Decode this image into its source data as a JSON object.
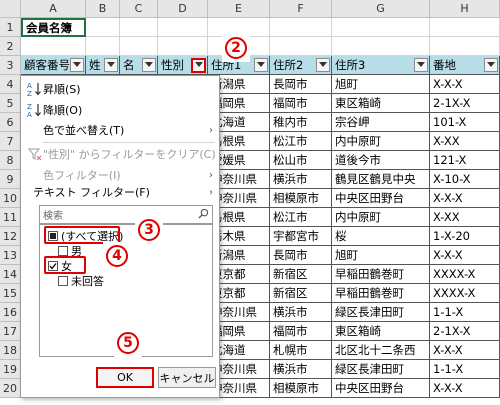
{
  "columns": [
    "A",
    "B",
    "C",
    "D",
    "E",
    "F",
    "G",
    "H"
  ],
  "row_numbers": [
    "1",
    "2",
    "3",
    "4",
    "5",
    "6",
    "7",
    "8",
    "9",
    "10",
    "11",
    "12",
    "13",
    "14",
    "15",
    "16",
    "17",
    "18",
    "19",
    "20"
  ],
  "sheet_title": "会員名簿",
  "table_headers": [
    "顧客番号",
    "姓",
    "名",
    "性別",
    "住所1",
    "住所2",
    "住所3",
    "番地"
  ],
  "table_rows": [
    [
      "新潟県",
      "長岡市",
      "旭町",
      "X-X-X"
    ],
    [
      "福岡県",
      "福岡市",
      "東区箱崎",
      "2-1X-X"
    ],
    [
      "北海道",
      "稚内市",
      "宗谷岬",
      "101-X"
    ],
    [
      "島根県",
      "松江市",
      "内中原町",
      "X-XX"
    ],
    [
      "愛媛県",
      "松山市",
      "道後今市",
      "121-X"
    ],
    [
      "神奈川県",
      "横浜市",
      "鶴見区鶴見中央",
      "X-10-X"
    ],
    [
      "神奈川県",
      "相模原市",
      "中央区田野台",
      "X-X-X"
    ],
    [
      "島根県",
      "松江市",
      "内中原町",
      "X-XX"
    ],
    [
      "栃木県",
      "宇都宮市",
      "桜",
      "1-X-20"
    ],
    [
      "新潟県",
      "長岡市",
      "旭町",
      "X-X-X"
    ],
    [
      "東京都",
      "新宿区",
      "早稲田鶴巻町",
      "XXXX-X"
    ],
    [
      "東京都",
      "新宿区",
      "早稲田鶴巻町",
      "XXXX-X"
    ],
    [
      "神奈川県",
      "横浜市",
      "緑区長津田町",
      "1-1-X"
    ],
    [
      "福岡県",
      "福岡市",
      "東区箱崎",
      "2-1X-X"
    ],
    [
      "北海道",
      "札幌市",
      "北区北十二条西",
      "X-X-X"
    ],
    [
      "神奈川県",
      "横浜市",
      "緑区長津田町",
      "1-1-X"
    ],
    [
      "神奈川県",
      "相模原市",
      "中央区田野台",
      "X-X-X"
    ]
  ],
  "menu": {
    "sort_asc": "昇順(S)",
    "sort_desc": "降順(O)",
    "sort_by_color": "色で並べ替え(T)",
    "clear_filter": "\"性別\" からフィルターをクリア(C)",
    "color_filter": "色フィルター(I)",
    "text_filter": "テキスト フィルター(F)"
  },
  "search": {
    "placeholder": "検索"
  },
  "filter_list": [
    {
      "label": "(すべて選択)",
      "state": "partial"
    },
    {
      "label": "男",
      "state": "unchecked"
    },
    {
      "label": "女",
      "state": "checked"
    },
    {
      "label": "未回答",
      "state": "unchecked"
    }
  ],
  "buttons": {
    "ok": "OK",
    "cancel": "キャンセル"
  },
  "callouts": [
    "2",
    "3",
    "4",
    "5"
  ],
  "colors": {
    "header_fill": "#b7dee8",
    "highlight": "#e00000",
    "title_border": "#217346"
  }
}
